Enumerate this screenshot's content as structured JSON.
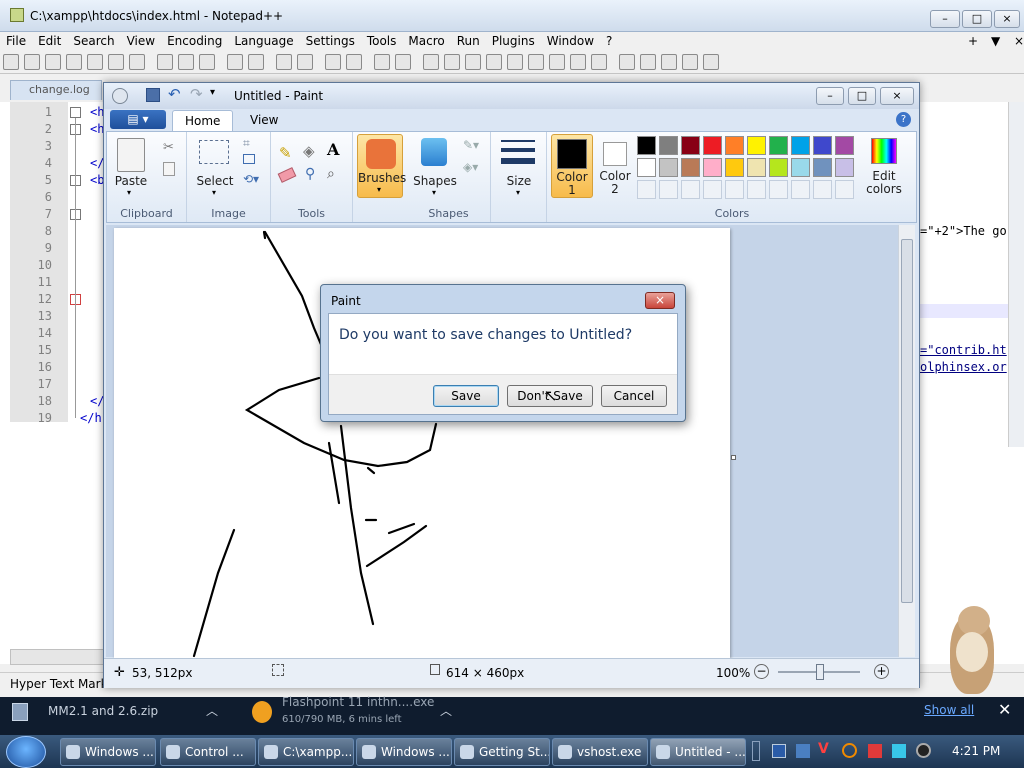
{
  "npp": {
    "title": "C:\\xampp\\htdocs\\index.html - Notepad++",
    "menu": [
      "File",
      "Edit",
      "Search",
      "View",
      "Encoding",
      "Language",
      "Settings",
      "Tools",
      "Macro",
      "Run",
      "Plugins",
      "Window",
      "?"
    ],
    "menu_right": [
      "+",
      "▼",
      "×"
    ],
    "tab": "change.log",
    "line_numbers": [
      "1",
      "2",
      "3",
      "4",
      "5",
      "6",
      "7",
      "8",
      "9",
      "10",
      "11",
      "12",
      "13",
      "14",
      "15",
      "16",
      "17",
      "18",
      "19"
    ],
    "code_fragments": [
      "<h",
      "<h",
      "</",
      "<b",
      "</",
      "</h"
    ],
    "right_code": [
      "=\"+2\">The go",
      "=\"contrib.ht",
      "olphinsex.or"
    ],
    "status_left": "Hyper Text Marku"
  },
  "paint": {
    "title": "Untitled - Paint",
    "tabs": {
      "home": "Home",
      "view": "View"
    },
    "groups": {
      "clipboard": "Clipboard",
      "image": "Image",
      "tools": "Tools",
      "shapes": "Shapes",
      "colors": "Colors"
    },
    "buttons": {
      "paste": "Paste",
      "select": "Select",
      "brushes": "Brushes",
      "shapes": "Shapes",
      "size": "Size",
      "color1": "Color 1",
      "color2": "Color 2",
      "edit_colors": "Edit colors"
    },
    "palette_row1": [
      "#000000",
      "#7f7f7f",
      "#880015",
      "#ed1c24",
      "#ff7f27",
      "#fff200",
      "#22b14c",
      "#00a2e8",
      "#3f48cc",
      "#a349a4"
    ],
    "palette_row2": [
      "#ffffff",
      "#c3c3c3",
      "#b97a57",
      "#ffaec9",
      "#ffc90e",
      "#efe4b0",
      "#b5e61d",
      "#99d9ea",
      "#7092be",
      "#c8bfe7"
    ],
    "status": {
      "cursor": "53, 512px",
      "size": "614 × 460px",
      "zoom": "100%"
    }
  },
  "dialog": {
    "title": "Paint",
    "message": "Do you want to save changes to Untitled?",
    "save": "Save",
    "dont_save": "Don't Save",
    "cancel": "Cancel"
  },
  "notifications": {
    "item1": "MM2.1 and 2.6.zip",
    "item2_title": "Flashpoint 11 inthn....exe",
    "item2_sub": "610/790 MB, 6 mins left",
    "show_all": "Show all"
  },
  "taskbar": {
    "buttons": [
      "Windows ...",
      "Control ...",
      "C:\\xampp...",
      "Windows ...",
      "Getting St...",
      "vshost.exe",
      "Untitled - ..."
    ],
    "clock": "4:21 PM"
  }
}
